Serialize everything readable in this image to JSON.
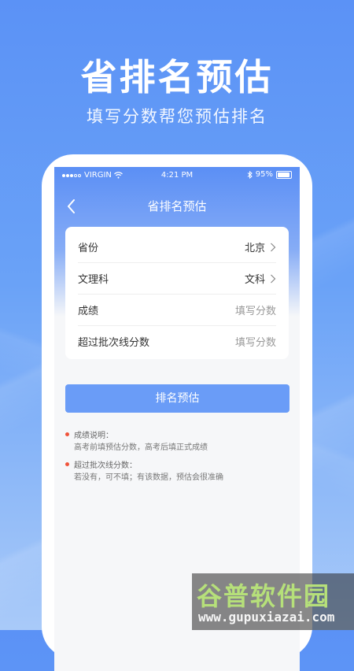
{
  "hero": {
    "title": "省排名预估",
    "subtitle": "填写分数帮您预估排名"
  },
  "status_bar": {
    "carrier": "VIRGIN",
    "time": "4:21 PM",
    "battery": "95%"
  },
  "nav": {
    "title": "省排名预估"
  },
  "form": {
    "rows": [
      {
        "label": "省份",
        "value": "北京",
        "has_arrow": true
      },
      {
        "label": "文理科",
        "value": "文科",
        "has_arrow": true
      },
      {
        "label": "成绩",
        "placeholder": "填写分数",
        "has_arrow": false
      },
      {
        "label": "超过批次线分数",
        "placeholder": "填写分数",
        "has_arrow": false
      }
    ]
  },
  "button": {
    "label": "排名预估"
  },
  "notes": [
    {
      "title": "成绩说明：",
      "text": "高考前填预估分数，高考后填正式成绩"
    },
    {
      "title": "超过批次线分数：",
      "text": "若没有，可不填；有该数据，预估会很准确"
    }
  ],
  "watermark": {
    "brand": "谷普软件园",
    "url": "www.gupuxiazai.com"
  },
  "colors": {
    "accent": "#6a9cf7",
    "note_dot": "#f0533a",
    "watermark_green": "#b6e07a"
  }
}
